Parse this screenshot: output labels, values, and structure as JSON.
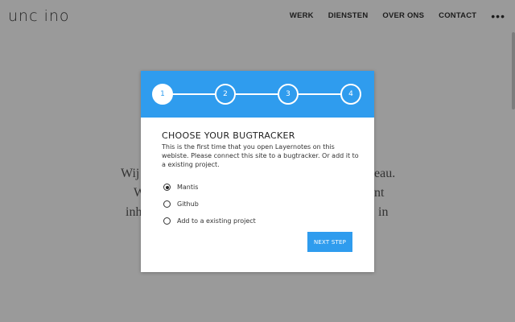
{
  "site": {
    "logo": "unc ino",
    "nav": {
      "items": [
        "WERK",
        "DIENSTEN",
        "OVER ONS",
        "CONTACT"
      ],
      "more": "•••"
    },
    "background_text": {
      "line1_left": "Wij",
      "line1_right": "eau.",
      "line2_left": "W",
      "line2_right": "nt",
      "line3_left": "inh",
      "line3_right": "in"
    }
  },
  "modal": {
    "steps": [
      "1",
      "2",
      "3",
      "4"
    ],
    "active_step": 1,
    "title": "CHOOSE YOUR BUGTRACKER",
    "description": "This is the first time that you open Layernotes on this webiste. Please connect this site to a bugtracker. Or add it to a existing project.",
    "options": [
      {
        "label": "Mantis",
        "checked": true
      },
      {
        "label": "Github",
        "checked": false
      },
      {
        "label": "Add to a existing project",
        "checked": false
      }
    ],
    "next_label": "NEXT STEP"
  },
  "colors": {
    "accent": "#2f9cee",
    "overlay": "#939393"
  }
}
